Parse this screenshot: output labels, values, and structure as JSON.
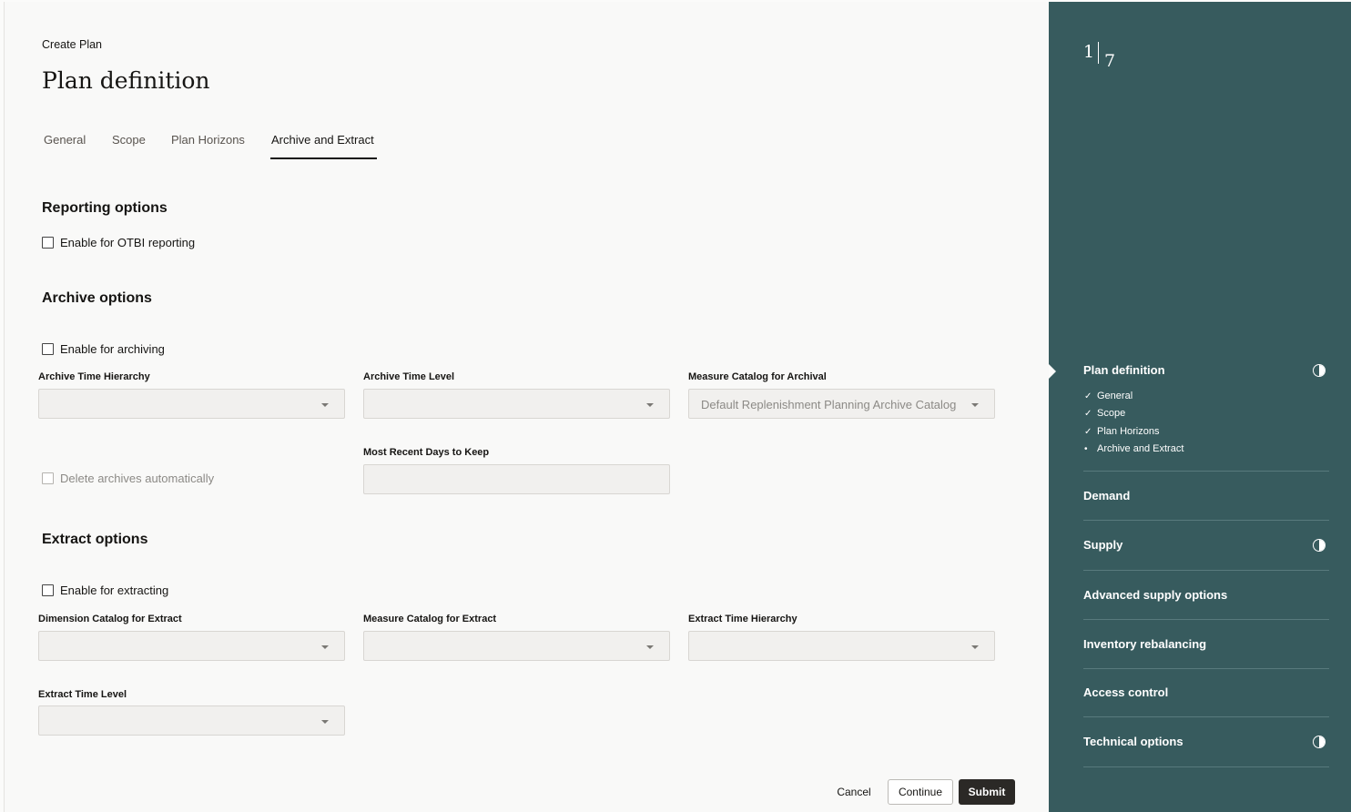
{
  "header": {
    "eyebrow": "Create Plan",
    "title": "Plan definition"
  },
  "tabs": [
    {
      "label": "General",
      "active": false
    },
    {
      "label": "Scope",
      "active": false
    },
    {
      "label": "Plan Horizons",
      "active": false
    },
    {
      "label": "Archive and Extract",
      "active": true
    }
  ],
  "reporting": {
    "heading": "Reporting options",
    "otbi_label": "Enable for OTBI reporting"
  },
  "archive": {
    "heading": "Archive options",
    "enable_label": "Enable for archiving",
    "time_hierarchy_label": "Archive Time Hierarchy",
    "time_hierarchy_value": "",
    "time_level_label": "Archive Time Level",
    "time_level_value": "",
    "measure_catalog_label": "Measure Catalog for Archival",
    "measure_catalog_value": "Default Replenishment Planning Archive Catalog",
    "delete_label": "Delete archives automatically",
    "days_label": "Most Recent Days to Keep",
    "days_value": ""
  },
  "extract": {
    "heading": "Extract options",
    "enable_label": "Enable for extracting",
    "dimension_catalog_label": "Dimension Catalog for Extract",
    "measure_catalog_label": "Measure Catalog for Extract",
    "time_hierarchy_label": "Extract Time Hierarchy",
    "time_level_label": "Extract Time Level"
  },
  "footer": {
    "cancel": "Cancel",
    "continue": "Continue",
    "submit": "Submit"
  },
  "sidebar": {
    "step_current": "1",
    "step_total": "7",
    "items": [
      {
        "label": "Plan definition",
        "status_icon": "half-circle-icon"
      },
      {
        "label": "Demand",
        "status_icon": ""
      },
      {
        "label": "Supply",
        "status_icon": "half-circle-icon"
      },
      {
        "label": "Advanced supply options",
        "status_icon": ""
      },
      {
        "label": "Inventory rebalancing",
        "status_icon": ""
      },
      {
        "label": "Access control",
        "status_icon": ""
      },
      {
        "label": "Technical options",
        "status_icon": "half-circle-icon"
      }
    ],
    "subitems": [
      {
        "label": "General",
        "mark": "✓"
      },
      {
        "label": "Scope",
        "mark": "✓"
      },
      {
        "label": "Plan Horizons",
        "mark": "✓"
      },
      {
        "label": "Archive and Extract",
        "mark": "•"
      }
    ]
  },
  "colors": {
    "sidebar_bg": "#375b5e",
    "primary_button": "#2b2926",
    "page_bg": "#f9f9f8"
  }
}
